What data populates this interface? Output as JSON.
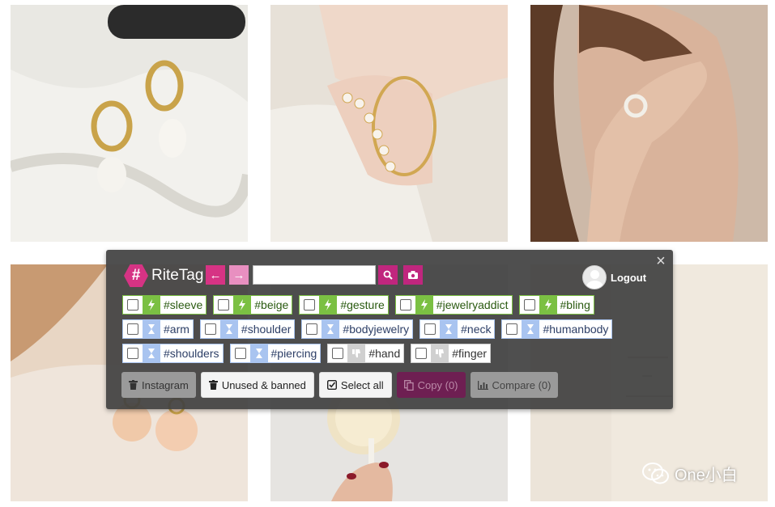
{
  "brand": {
    "name": "RiteTag",
    "logo_glyph": "#",
    "color": "#d63384"
  },
  "toolbar": {
    "back_icon": "arrow-left-icon",
    "forward_icon": "arrow-right-icon",
    "search": {
      "value": "",
      "placeholder": ""
    },
    "search_icon": "magnifier-icon",
    "camera_icon": "camera-icon",
    "logout_label": "Logout"
  },
  "tags": {
    "row1": [
      {
        "text": "#sleeve",
        "status": "green",
        "icon": "lightning-icon"
      },
      {
        "text": "#beige",
        "status": "green",
        "icon": "lightning-icon"
      },
      {
        "text": "#gesture",
        "status": "green",
        "icon": "lightning-icon"
      },
      {
        "text": "#jewelryaddict",
        "status": "green",
        "icon": "lightning-icon"
      },
      {
        "text": "#bling",
        "status": "green",
        "icon": "lightning-icon"
      }
    ],
    "row2": [
      {
        "text": "#arm",
        "status": "blue",
        "icon": "hourglass-icon"
      },
      {
        "text": "#shoulder",
        "status": "blue",
        "icon": "hourglass-icon"
      },
      {
        "text": "#bodyjewelry",
        "status": "blue",
        "icon": "hourglass-icon"
      },
      {
        "text": "#neck",
        "status": "blue",
        "icon": "hourglass-icon"
      },
      {
        "text": "#humanbody",
        "status": "blue",
        "icon": "hourglass-icon"
      }
    ],
    "row3": [
      {
        "text": "#shoulders",
        "status": "blue",
        "icon": "hourglass-icon"
      },
      {
        "text": "#piercing",
        "status": "blue",
        "icon": "hourglass-icon"
      },
      {
        "text": "#hand",
        "status": "gray",
        "icon": "thumbs-down-icon"
      },
      {
        "text": "#finger",
        "status": "gray",
        "icon": "thumbs-down-icon"
      }
    ]
  },
  "buttons": {
    "instagram": "Instagram",
    "unused_banned": "Unused & banned",
    "select_all": "Select all",
    "copy": "Copy (0)",
    "compare": "Compare (0)"
  },
  "watermark": {
    "text": "One小白",
    "icon": "wechat-icon"
  },
  "colors": {
    "accent": "#c0267e",
    "nav_back": "#d63384",
    "nav_forward": "#e88fc0",
    "green_tag": "#7bc043",
    "blue_tag": "#a9c4f0"
  }
}
